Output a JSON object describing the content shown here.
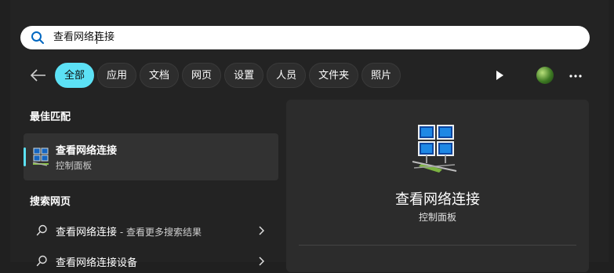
{
  "search": {
    "value": "查看网络连接"
  },
  "filters": [
    "全部",
    "应用",
    "文档",
    "网页",
    "设置",
    "人员",
    "文件夹",
    "照片"
  ],
  "sections": {
    "best_match": "最佳匹配",
    "search_web": "搜索网页"
  },
  "best_match": {
    "title": "查看网络连接",
    "subtitle": "控制面板"
  },
  "web_results": [
    {
      "text": "查看网络连接",
      "suffix": " - 查看更多搜索结果"
    },
    {
      "text": "查看网络连接设备",
      "suffix": ""
    }
  ],
  "detail": {
    "title": "查看网络连接",
    "subtitle": "控制面板"
  },
  "colors": {
    "accent": "#5ce1f5",
    "background": "#202020",
    "panel": "#2c2c2c"
  }
}
